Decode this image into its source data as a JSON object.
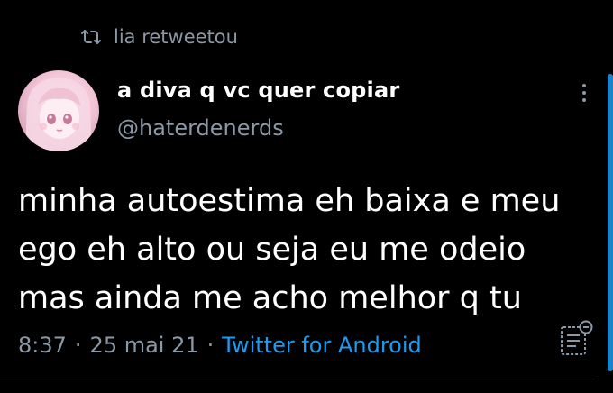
{
  "social_context": {
    "text": "lia retweetou",
    "icon": "retweet-icon"
  },
  "author": {
    "display_name": "a diva q vc quer copiar",
    "handle": "@haterdenerds",
    "avatar": "anime-girl-avatar"
  },
  "tweet": {
    "text": "minha autoestima eh baixa e meu\nego eh alto ou seja eu me odeio\nmas ainda me acho melhor q tu"
  },
  "meta": {
    "time": "8:37",
    "date": "25 mai 21",
    "separator": "·",
    "source": "Twitter for Android"
  },
  "icons": {
    "more": "more-vertical-icon",
    "translate": "translate-icon"
  },
  "colors": {
    "background": "#000000",
    "link": "#1d9bf0",
    "muted": "#8b98a5",
    "text": "#ffffff"
  }
}
